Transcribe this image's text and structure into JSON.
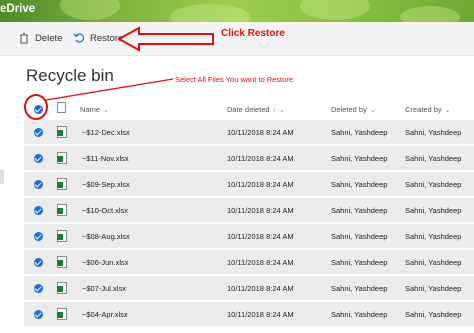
{
  "brand": "eDrive",
  "toolbar": {
    "delete_label": "Delete",
    "restore_label": "Restore"
  },
  "annotations": {
    "restore": "Click Restore",
    "select_all": "Select All Files You want to Restore."
  },
  "page_title": "Recycle bin",
  "columns": {
    "name": "Name",
    "date_deleted": "Date deleted",
    "deleted_by": "Deleted by",
    "created_by": "Created by"
  },
  "rows": [
    {
      "name": "~$12-Dec.xlsx",
      "date_deleted": "10/11/2018 8:24 AM",
      "deleted_by": "Sahni, Yashdeep",
      "created_by": "Sahni, Yashdeep"
    },
    {
      "name": "~$11-Nov.xlsx",
      "date_deleted": "10/11/2018 8:24 AM",
      "deleted_by": "Sahni, Yashdeep",
      "created_by": "Sahni, Yashdeep"
    },
    {
      "name": "~$09-Sep.xlsx",
      "date_deleted": "10/11/2018 8:24 AM",
      "deleted_by": "Sahni, Yashdeep",
      "created_by": "Sahni, Yashdeep"
    },
    {
      "name": "~$10-Oct.xlsx",
      "date_deleted": "10/11/2018 8:24 AM",
      "deleted_by": "Sahni, Yashdeep",
      "created_by": "Sahni, Yashdeep"
    },
    {
      "name": "~$08-Aug.xlsx",
      "date_deleted": "10/11/2018 8:24 AM",
      "deleted_by": "Sahni, Yashdeep",
      "created_by": "Sahni, Yashdeep"
    },
    {
      "name": "~$06-Jun.xlsx",
      "date_deleted": "10/11/2018 8:24 AM",
      "deleted_by": "Sahni, Yashdeep",
      "created_by": "Sahni, Yashdeep"
    },
    {
      "name": "~$07-Jul.xlsx",
      "date_deleted": "10/11/2018 8:24 AM",
      "deleted_by": "Sahni, Yashdeep",
      "created_by": "Sahni, Yashdeep"
    },
    {
      "name": "~$04-Apr.xlsx",
      "date_deleted": "10/11/2018 8:24 AM",
      "deleted_by": "Sahni, Yashdeep",
      "created_by": "Sahni, Yashdeep"
    }
  ],
  "colors": {
    "accent": "#1e6fd0",
    "annotation": "#e01010",
    "row_bg": "#ececec"
  }
}
